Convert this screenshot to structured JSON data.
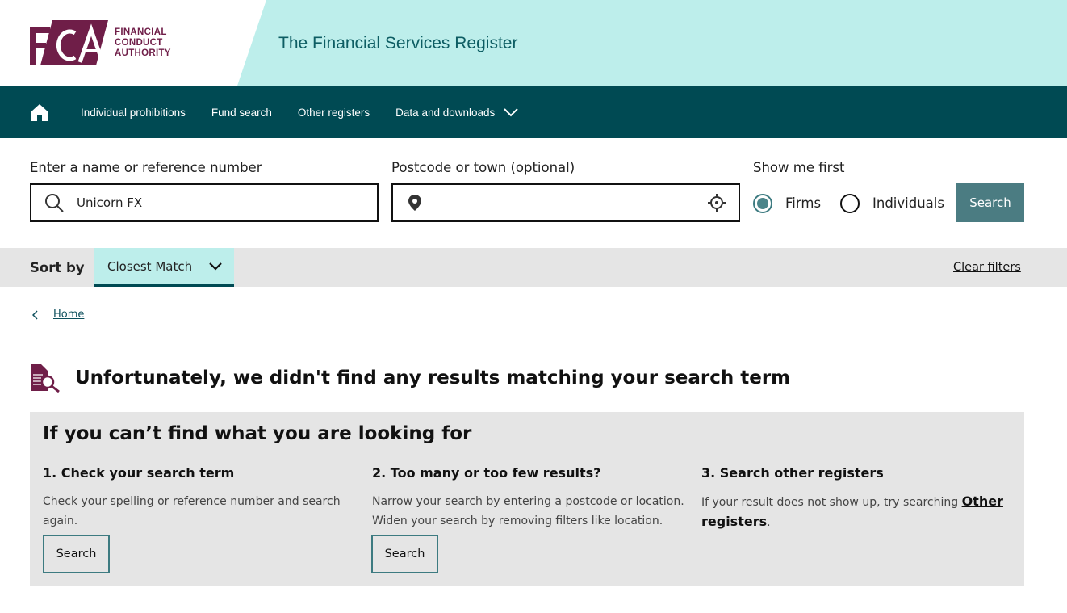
{
  "header": {
    "logo_letters": "FCA",
    "logo_text": [
      "FINANCIAL",
      "CONDUCT",
      "AUTHORITY"
    ],
    "title": "The Financial Services Register"
  },
  "nav": {
    "items": [
      {
        "label": "Individual prohibitions"
      },
      {
        "label": "Fund search"
      },
      {
        "label": "Other registers"
      },
      {
        "label": "Data and downloads"
      }
    ]
  },
  "search": {
    "name_label": "Enter a name or reference number",
    "name_value": "Unicorn FX",
    "postcode_label": "Postcode or town (optional)",
    "postcode_value": "",
    "show_label": "Show me first",
    "options": [
      {
        "label": "Firms",
        "selected": true
      },
      {
        "label": "Individuals",
        "selected": false
      }
    ],
    "button": "Search"
  },
  "sort": {
    "label": "Sort by",
    "value": "Closest Match",
    "clear": "Clear filters"
  },
  "breadcrumb": {
    "home": "Home"
  },
  "message": "Unfortunately, we didn't find any results matching your search term",
  "help": {
    "title": "If you can’t find what you are looking for",
    "cols": [
      {
        "title": "1. Check your search term",
        "text": "Check your spelling or reference number and search again.",
        "button": "Search"
      },
      {
        "title": "2. Too many or too few results?",
        "text": "Narrow your search by entering a postcode or location. Widen your search by removing filters like location.",
        "button": "Search"
      },
      {
        "title": "3. Search other registers",
        "text": "If your result does not show up, try searching ",
        "link": "Other registers",
        "after": "."
      }
    ]
  },
  "colors": {
    "brand": "#6f1e48",
    "nav": "#004a53",
    "accent": "#bdeeeb",
    "button": "#4b7c82"
  }
}
